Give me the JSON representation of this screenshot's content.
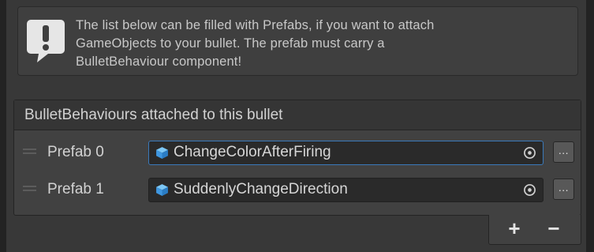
{
  "helpbox": {
    "icon": "warning-speech-bubble-icon",
    "lines": [
      "The list below can be filled with Prefabs, if you want to attach",
      "GameObjects to your bullet. The prefab must carry a",
      "BulletBehaviour component!"
    ]
  },
  "list": {
    "title": "BulletBehaviours attached to this bullet",
    "rows": [
      {
        "label": "Prefab 0",
        "value": "ChangeColorAfterFiring",
        "more": "..."
      },
      {
        "label": "Prefab 1",
        "value": "SuddenlyChangeDirection",
        "more": "..."
      }
    ],
    "add_label": "+",
    "remove_label": "−"
  },
  "colors": {
    "background": "#383838",
    "field_bg": "#2a2a2a",
    "focus_border": "#3a79bb",
    "prefab_icon": "#4aa3e8"
  }
}
